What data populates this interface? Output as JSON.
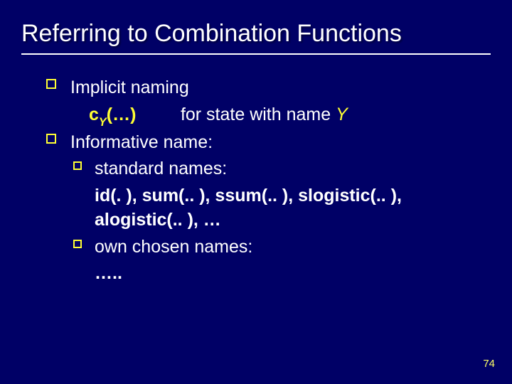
{
  "title": "Referring to Combination Functions",
  "bullets": {
    "implicit": {
      "label": "Implicit naming",
      "func_c": "c",
      "func_sub": "Y",
      "func_args": "(…)",
      "for_text": "for state with name ",
      "state_name": "Y"
    },
    "informative": {
      "label": "Informative name:",
      "standard_label": "standard names:",
      "standard_items": "id(. ), sum(.. ), ssum(.. ), slogistic(.. ), alogistic(.. ), …",
      "own_label": "own chosen names:",
      "own_items": "….."
    }
  },
  "pagenum": "74"
}
